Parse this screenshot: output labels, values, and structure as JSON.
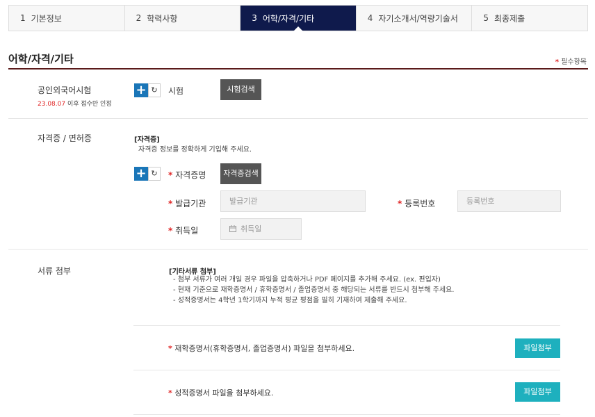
{
  "steps": [
    {
      "num": "1",
      "label": "기본정보"
    },
    {
      "num": "2",
      "label": "학력사항"
    },
    {
      "num": "3",
      "label": "어학/자격/기타"
    },
    {
      "num": "4",
      "label": "자기소개서/역량기술서"
    },
    {
      "num": "5",
      "label": "최종제출"
    }
  ],
  "section": {
    "title": "어학/자격/기타",
    "required_legend": "필수항목",
    "star": "*"
  },
  "language": {
    "label": "공인외국어시험",
    "note_date": "23.08.07",
    "note_text": " 이후 점수만 인정",
    "plus": "+",
    "reset": "↻",
    "exam_label": "시험",
    "search_button": "시험검색"
  },
  "license": {
    "label": "자격증 / 면허증",
    "heading": "[자격증]",
    "guide": "자격증 정보를 정확하게 기입해 주세요.",
    "plus": "+",
    "reset": "↻",
    "name_label": "자격증명",
    "search_button": "자격증검색",
    "issuer_label": "발급기관",
    "issuer_placeholder": "발급기관",
    "regno_label": "등록번호",
    "regno_placeholder": "등록번호",
    "date_label": "취득일",
    "date_placeholder": "취득일"
  },
  "documents": {
    "label": "서류 첨부",
    "heading": "[기타서류 첨부]",
    "guides": [
      "- 첨부 서류가 여러 개일 경우 파일을 압축하거나 PDF 페이지를 추가해 주세요. (ex. 편입자)",
      "- 현재 기준으로 재학증명서 / 휴학증명서 / 졸업증명서 중 해당되는 서류를 반드시 첨부해 주세요.",
      "- 성적증명서는 4학년 1학기까지 누적 평균 평점을 필히 기재하여 제출해 주세요."
    ],
    "attach1_text": "재학증명서(휴학증명서, 졸업증명서) 파일을 첨부하세요.",
    "attach1_button": "파일첨부",
    "attach2_text": "성적증명서 파일을 첨부하세요.",
    "attach2_button": "파일첨부"
  }
}
